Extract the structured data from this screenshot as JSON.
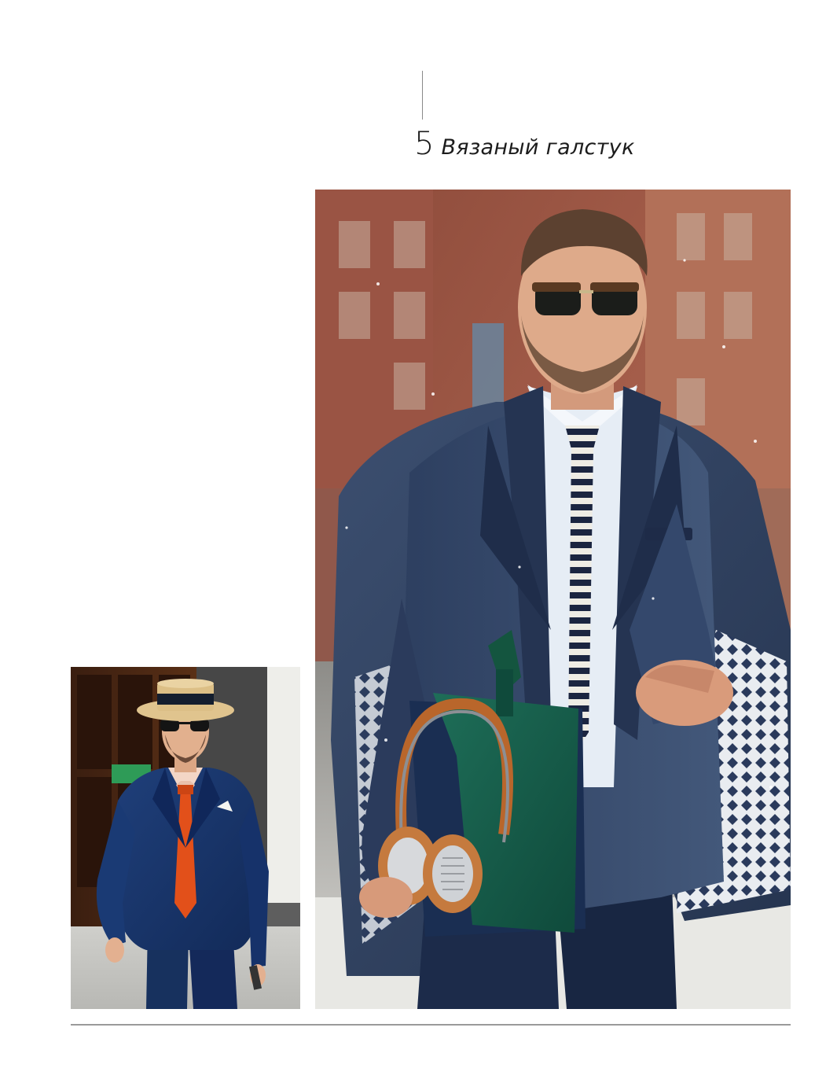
{
  "section": {
    "number": "5",
    "title": "Вязаный галстук"
  },
  "photos": {
    "main_icon": "photo-street-style-knit-tie",
    "small_icon": "photo-street-style-boater-hat"
  },
  "colors": {
    "text": "#1c1c1c",
    "rule": "#9a9a9a",
    "background": "#ffffff"
  }
}
